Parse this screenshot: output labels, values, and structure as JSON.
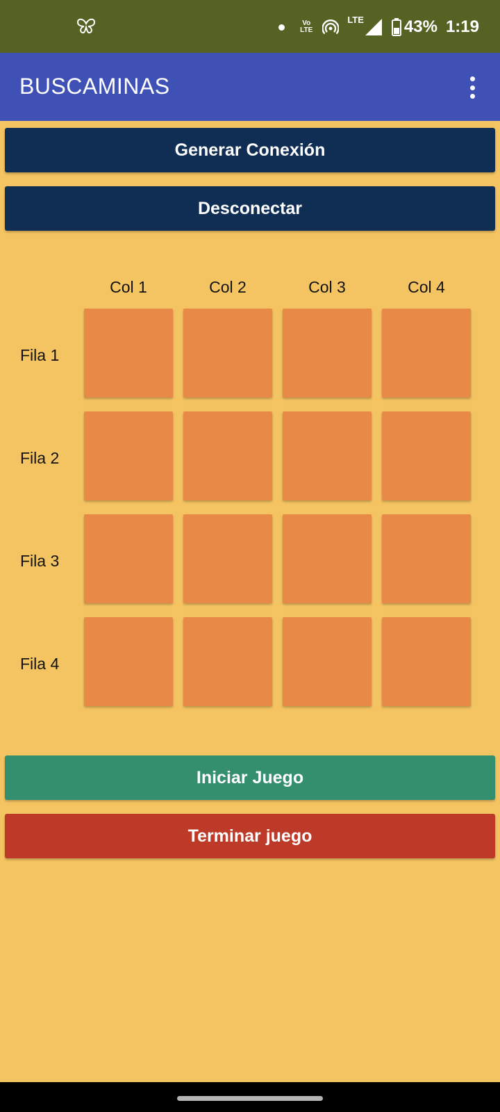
{
  "status_bar": {
    "battery_percent": "43%",
    "time": "1:19",
    "network_label": "LTE",
    "volte_top": "Vo",
    "volte_bottom": "LTE",
    "icons": [
      "butterfly-icon",
      "notification-dot-icon",
      "volte-icon",
      "hotspot-icon",
      "lte-signal-icon",
      "battery-icon"
    ]
  },
  "app_bar": {
    "title": "BUSCAMINAS",
    "menu_icon": "more-vert-icon"
  },
  "buttons": {
    "connect": "Generar Conexión",
    "disconnect": "Desconectar",
    "start": "Iniciar Juego",
    "end": "Terminar juego"
  },
  "grid": {
    "columns": [
      "Col 1",
      "Col 2",
      "Col 3",
      "Col 4"
    ],
    "rows": [
      "Fila 1",
      "Fila 2",
      "Fila 3",
      "Fila 4"
    ]
  },
  "colors": {
    "status_bar": "#546323",
    "app_bar": "#3F51B5",
    "background": "#F5C462",
    "connection_buttons": "#102E53",
    "cell": "#E78A48",
    "start_button": "#338F6E",
    "end_button": "#BD3A29"
  }
}
